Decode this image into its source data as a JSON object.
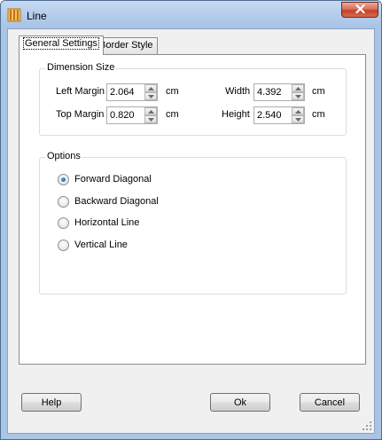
{
  "window": {
    "title": "Line"
  },
  "icons": {
    "app": "line-chart-icon",
    "close": "close-icon",
    "spin_up": "arrow-up-icon",
    "spin_down": "arrow-down-icon",
    "grip": "resize-grip-icon"
  },
  "tabs": [
    {
      "label": "General Settings",
      "active": true
    },
    {
      "label": "Border Style",
      "active": false
    }
  ],
  "dimension": {
    "legend": "Dimension Size",
    "left_margin": {
      "label": "Left Margin",
      "value": "2.064",
      "unit": "cm"
    },
    "top_margin": {
      "label": "Top Margin",
      "value": "0.820",
      "unit": "cm"
    },
    "width": {
      "label": "Width",
      "value": "4.392",
      "unit": "cm"
    },
    "height": {
      "label": "Height",
      "value": "2.540",
      "unit": "cm"
    }
  },
  "options": {
    "legend": "Options",
    "items": [
      {
        "label": "Forward Diagonal",
        "checked": true
      },
      {
        "label": "Backward Diagonal",
        "checked": false
      },
      {
        "label": "Horizontal Line",
        "checked": false
      },
      {
        "label": "Vertical Line",
        "checked": false
      }
    ]
  },
  "buttons": {
    "help": "Help",
    "ok": "Ok",
    "cancel": "Cancel"
  },
  "colors": {
    "title_bar": "#b5cdeb",
    "close": "#c4412a",
    "radio_dot": "#134e91"
  }
}
